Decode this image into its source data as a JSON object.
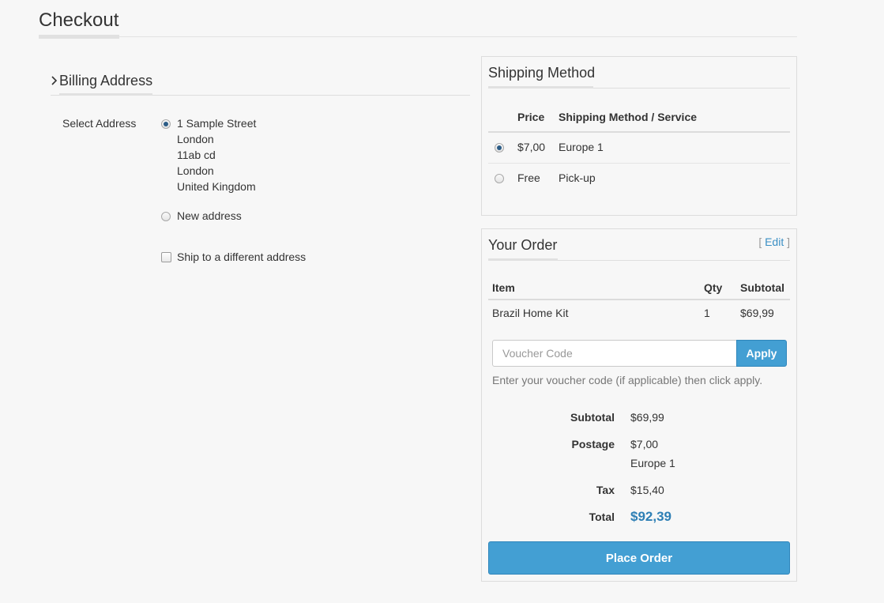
{
  "page": {
    "title": "Checkout"
  },
  "billing": {
    "title": "Billing Address",
    "select_label": "Select Address",
    "saved_address": [
      "1 Sample Street",
      "London",
      "11ab cd",
      "London",
      "United Kingdom"
    ],
    "new_address_label": "New address",
    "ship_different_label": "Ship to a different address"
  },
  "shipping": {
    "title": "Shipping Method",
    "headers": {
      "price": "Price",
      "service": "Shipping Method / Service"
    },
    "options": [
      {
        "price": "$7,00",
        "service": "Europe 1",
        "selected": true
      },
      {
        "price": "Free",
        "service": "Pick-up",
        "selected": false
      }
    ]
  },
  "order": {
    "title": "Your Order",
    "edit_open": "[",
    "edit_label": "Edit",
    "edit_close": "]",
    "headers": {
      "item": "Item",
      "qty": "Qty",
      "subtotal": "Subtotal"
    },
    "items": [
      {
        "name": "Brazil Home Kit",
        "qty": "1",
        "subtotal": "$69,99"
      }
    ],
    "voucher": {
      "placeholder": "Voucher Code",
      "apply_label": "Apply",
      "help": "Enter your voucher code (if applicable) then click apply."
    },
    "summary": {
      "subtotal_label": "Subtotal",
      "subtotal_value": "$69,99",
      "postage_label": "Postage",
      "postage_value": "$7,00",
      "postage_method": "Europe 1",
      "tax_label": "Tax",
      "tax_value": "$15,40",
      "total_label": "Total",
      "total_value": "$92,39"
    },
    "place_order_label": "Place Order"
  },
  "colors": {
    "accent": "#439fd3",
    "total": "#2e7fb5",
    "link": "#3a8fc4",
    "radio_selected": "#2b5c86"
  }
}
